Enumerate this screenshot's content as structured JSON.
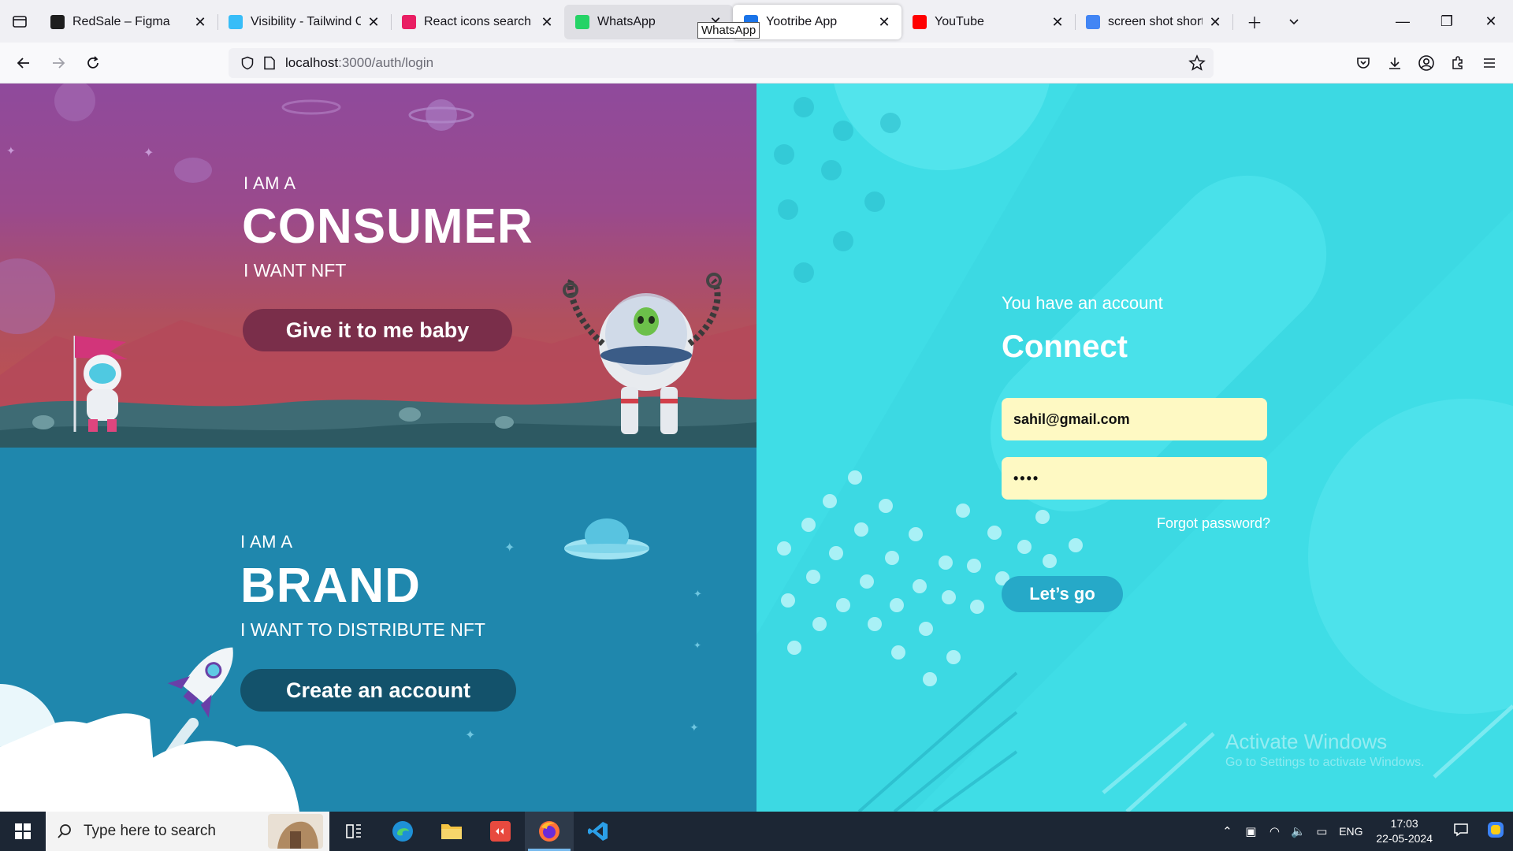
{
  "browser": {
    "tabs": [
      {
        "label": "RedSale – Figma",
        "icon": "figma-icon",
        "color": "#1e1e1e",
        "state": "normal"
      },
      {
        "label": "Visibility - Tailwind CSS",
        "icon": "tailwind-icon",
        "color": "#38bdf8",
        "state": "normal"
      },
      {
        "label": "React icons search results",
        "icon": "react-icons-icon",
        "color": "#e91e63",
        "state": "normal"
      },
      {
        "label": "WhatsApp",
        "icon": "whatsapp-icon",
        "color": "#25d366",
        "state": "hover"
      },
      {
        "label": "Yootribe App",
        "icon": "yootribe-icon",
        "color": "#1a73e8",
        "state": "active"
      },
      {
        "label": "YouTube",
        "icon": "youtube-icon",
        "color": "#ff0000",
        "state": "normal"
      },
      {
        "label": "screen shot shortcut key",
        "icon": "google-icon",
        "color": "#4285f4",
        "state": "normal"
      }
    ],
    "tooltip": "WhatsApp",
    "url_host": "localhost",
    "url_path": ":3000/auth/login"
  },
  "consumer": {
    "pre": "I AM A",
    "title": "CONSUMER",
    "sub": "I WANT NFT",
    "button": "Give it to me baby",
    "button_color": "#7a2e4a"
  },
  "brand": {
    "pre": "I AM A",
    "title": "BRAND",
    "sub": "I WANT TO DISTRIBUTE NFT",
    "button": "Create an account",
    "button_color": "#13526b"
  },
  "login": {
    "pre": "You have an account",
    "title": "Connect",
    "email_value": "sahil@gmail.com",
    "password_value": "••••",
    "forgot": "Forgot password?",
    "submit": "Let’s go",
    "watermark_title": "Activate Windows",
    "watermark_sub": "Go to Settings to activate Windows."
  },
  "taskbar": {
    "search_placeholder": "Type here to search",
    "language": "ENG",
    "time": "17:03",
    "date": "22-05-2024"
  }
}
